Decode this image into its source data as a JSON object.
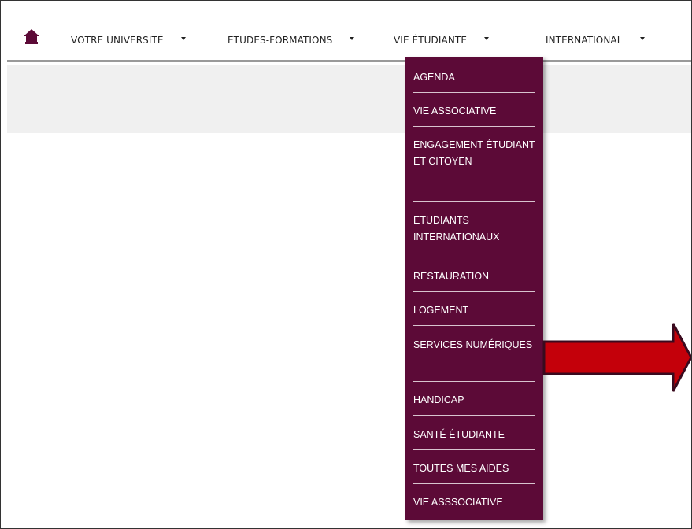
{
  "navbar": {
    "home_icon": "home-icon",
    "items": [
      {
        "label": "VOTRE UNIVERSITÉ"
      },
      {
        "label": "ETUDES-FORMATIONS"
      },
      {
        "label": "VIE ÉTUDIANTE"
      },
      {
        "label": "INTERNATIONAL"
      }
    ]
  },
  "dropdown": {
    "items": [
      {
        "label": "AGENDA"
      },
      {
        "label": "VIE ASSOCIATIVE"
      },
      {
        "label": "ENGAGEMENT ÉTUDIANT ET CITOYEN"
      },
      {
        "label": "ETUDIANTS INTERNATIONAUX"
      },
      {
        "label": "RESTAURATION"
      },
      {
        "label": "LOGEMENT"
      },
      {
        "label": "SERVICES NUMÉRIQUES"
      },
      {
        "label": "HANDICAP"
      },
      {
        "label": "SANTÉ ÉTUDIANTE"
      },
      {
        "label": "TOUTES MES AIDES"
      },
      {
        "label": "VIE ASSSOCIATIVE"
      }
    ]
  },
  "colors": {
    "menu_background": "#5c0a37",
    "arrow_fill": "#c4000a",
    "arrow_outline": "#3a0a1e",
    "grey_band": "#f0f0f0"
  }
}
